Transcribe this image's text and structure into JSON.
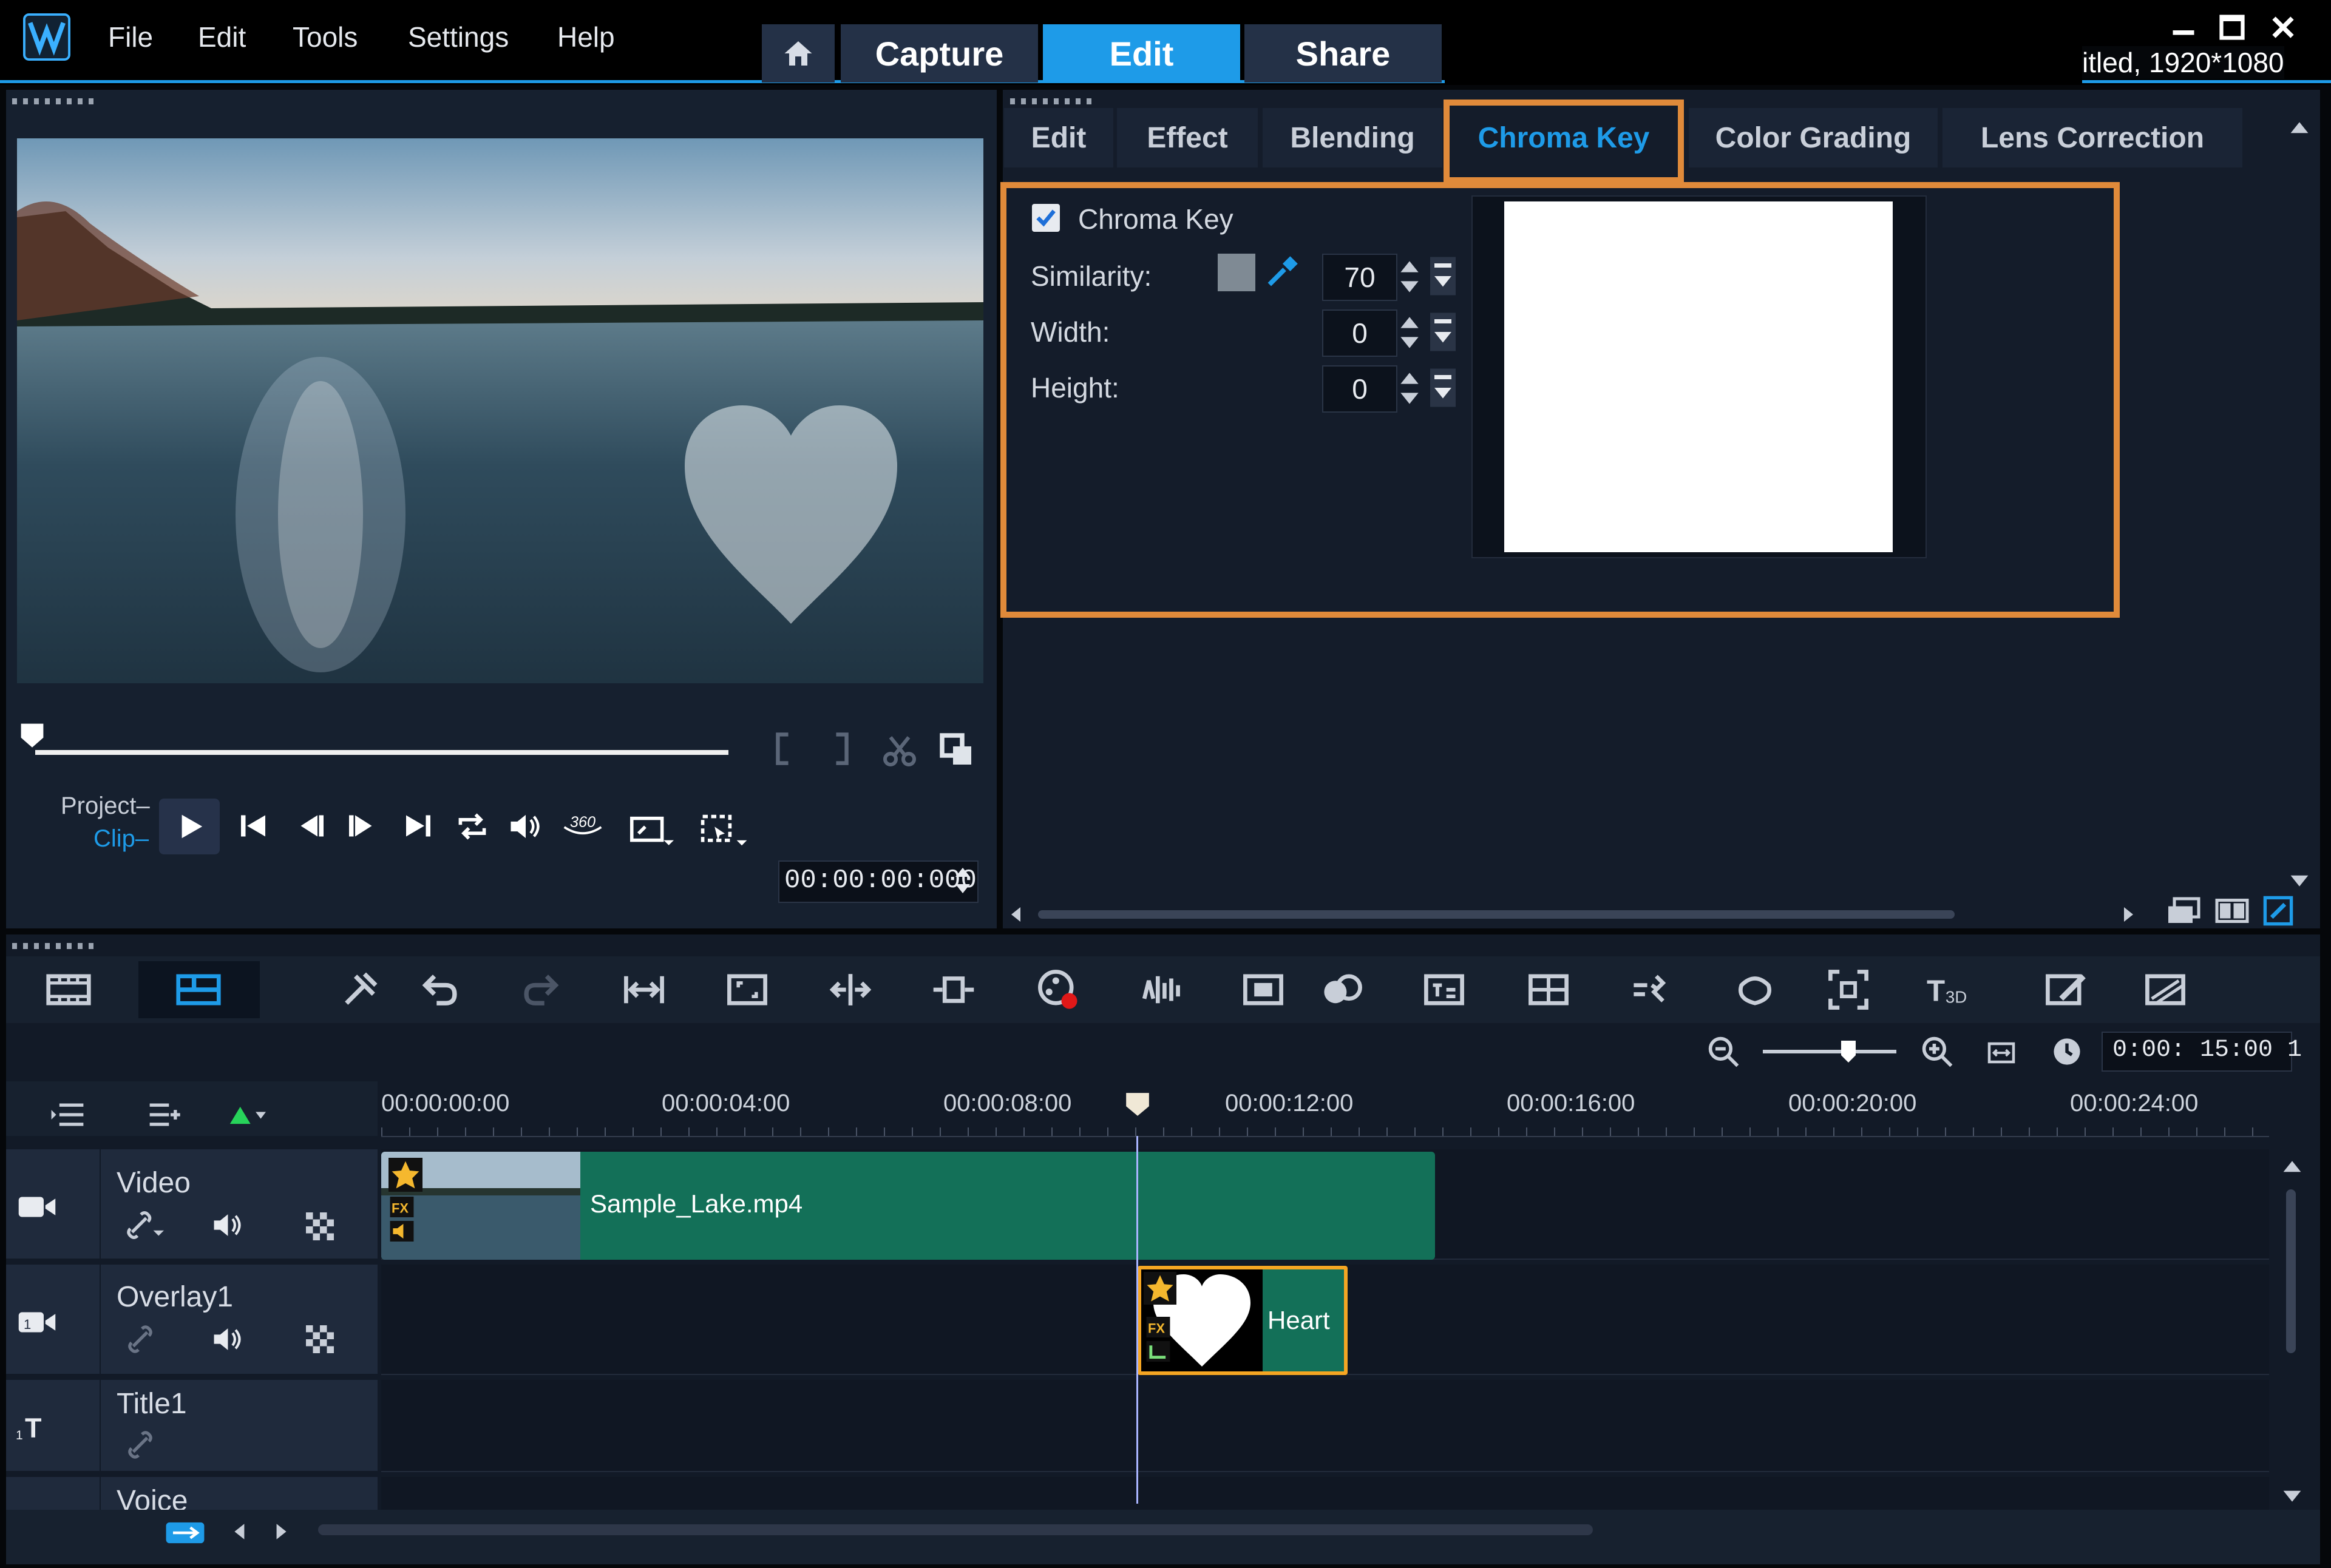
{
  "menu": {
    "file": "File",
    "edit": "Edit",
    "tools": "Tools",
    "settings": "Settings",
    "help": "Help"
  },
  "top_tabs": {
    "capture": "Capture",
    "edit": "Edit",
    "share": "Share"
  },
  "project_info": "itled, 1920*1080",
  "panel_tabs": [
    "Edit",
    "Effect",
    "Blending",
    "Chroma Key",
    "Color Grading",
    "Lens Correction"
  ],
  "chroma": {
    "checkbox_label": "Chroma Key",
    "similarity_label": "Similarity:",
    "width_label": "Width:",
    "height_label": "Height:",
    "similarity_value": "70",
    "width_value": "0",
    "height_value": "0",
    "key_color": "#7f8a94"
  },
  "player": {
    "project_label": "Project",
    "clip_label": "Clip",
    "timecode": "00:00:00:000"
  },
  "zoom": {
    "duration": "0:00: 15:00 1"
  },
  "ruler": [
    "00:00:00:00",
    "00:00:04:00",
    "00:00:08:00",
    "00:00:12:00",
    "00:00:16:00",
    "00:00:20:00",
    "00:00:24:00"
  ],
  "tracks": {
    "video": "Video",
    "overlay": "Overlay1",
    "title": "Title1",
    "voice": "Voice"
  },
  "clips": {
    "video_clip": "Sample_Lake.mp4",
    "overlay_clip": "Heart"
  },
  "colors": {
    "accent": "#1e9be8",
    "highlight": "#e08a3a",
    "clip_green": "#137058",
    "panel_bg": "#141c2a"
  }
}
